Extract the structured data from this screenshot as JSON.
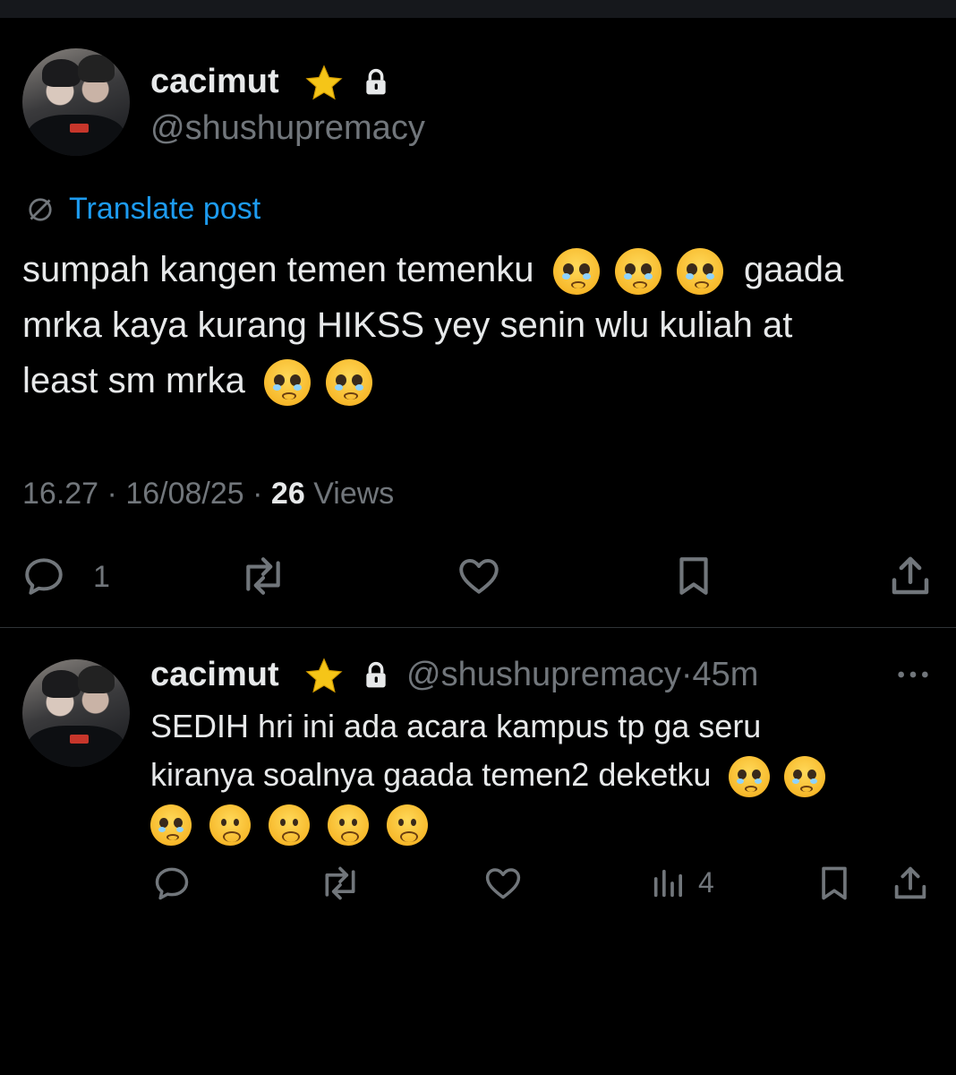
{
  "main_post": {
    "display_name": "cacimut",
    "handle": "@shushupremacy",
    "translate_label": "Translate post",
    "text_lines": [
      "sumpah kangen temen temenku",
      "gaada",
      "mrka kaya kurang HIKSS yey senin wlu kuliah at",
      "least sm mrka"
    ],
    "time": "16.27",
    "date": "16/08/25",
    "views_count": "26",
    "views_label": "Views",
    "reply_count": "1"
  },
  "reply_post": {
    "display_name": "cacimut",
    "handle": "@shushupremacy",
    "time_ago": "45m",
    "text_lines": [
      "SEDIH hri ini ada acara kampus tp ga seru",
      "kiranya soalnya gaada temen2 deketku"
    ],
    "views_count": "4"
  },
  "separator": "·",
  "icons": {
    "verified": "star-icon",
    "protected": "lock-icon",
    "translate": "globe-slash-icon",
    "reply": "reply-icon",
    "repost": "repost-icon",
    "like": "heart-icon",
    "bookmark": "bookmark-icon",
    "share": "share-icon",
    "views": "views-icon",
    "more": "more-icon",
    "pleading": "pleading-face-emoji",
    "frowning": "frowning-face-emoji"
  },
  "colors": {
    "background": "#000000",
    "text": "#e7e9ea",
    "muted": "#71767b",
    "link": "#1d9bf0",
    "star": "#f5c518"
  }
}
